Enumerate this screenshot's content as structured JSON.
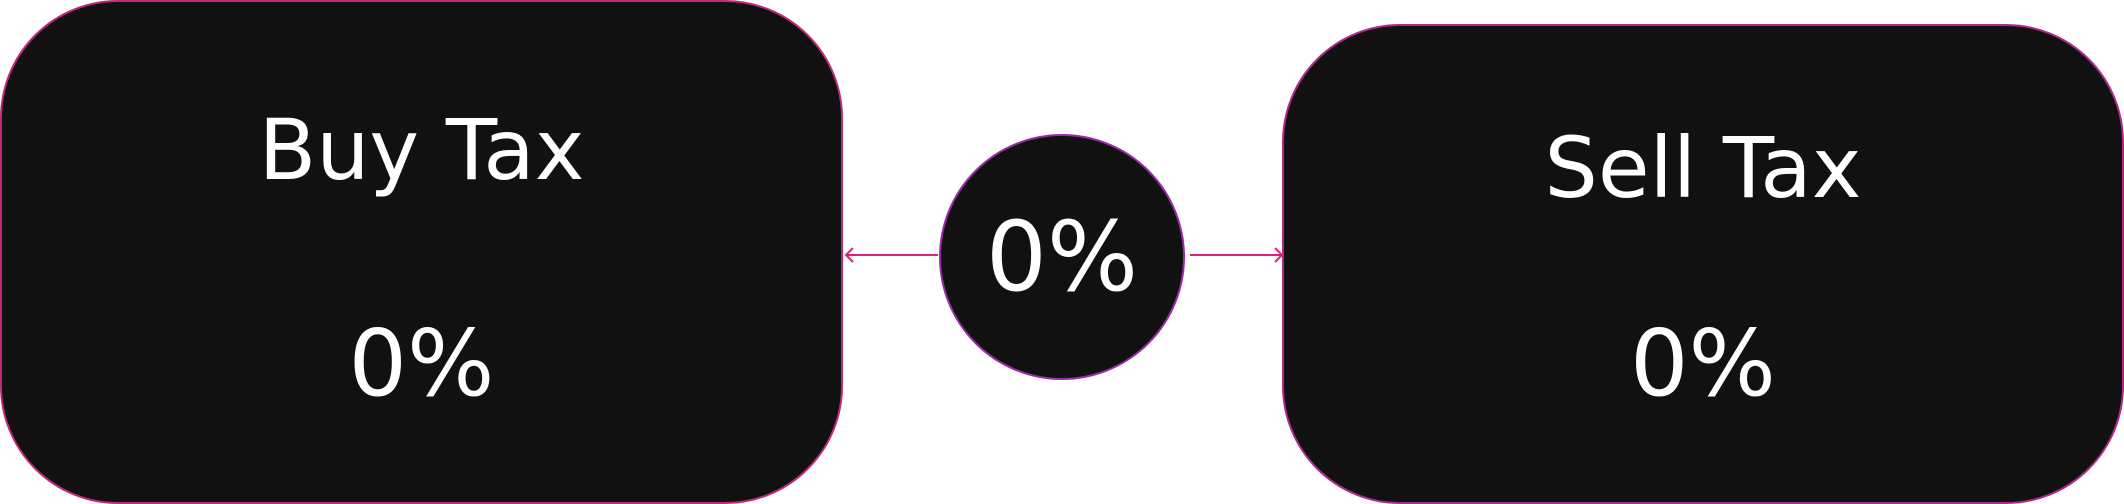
{
  "buy": {
    "title": "Buy Tax",
    "value": "0%"
  },
  "center": {
    "value": "0%"
  },
  "sell": {
    "title": "Sell Tax",
    "value": "0%"
  },
  "colors": {
    "panel_fill": "#111111",
    "border_accent_pink": "#e0215f",
    "border_accent_purple": "#7a2bd6",
    "arrow": "#e0217a",
    "text": "#ffffff"
  }
}
